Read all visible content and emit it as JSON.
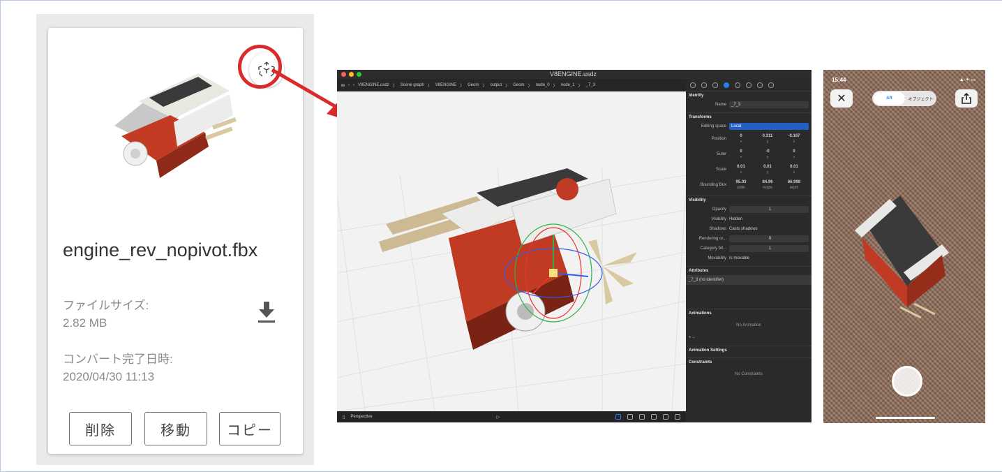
{
  "file_card": {
    "filename": "engine_rev_nopivot.fbx",
    "size_label": "ファイルサイズ:",
    "size_value": "2.82 MB",
    "date_label": "コンバート完了日時:",
    "date_value": "2020/04/30 11:13",
    "buttons": {
      "delete": "削除",
      "move": "移動",
      "copy": "コピー"
    },
    "accent_red": "#d92b2b"
  },
  "reality_composer": {
    "doc_title": "V8ENGINE.usdz",
    "path": [
      "V8ENGINE.usdz",
      "Scene graph",
      "V8ENGINE",
      "Geom",
      "output",
      "Geom",
      "node_0",
      "node_1",
      "_7_3"
    ],
    "bottom_bar": {
      "camera": "Perspective"
    },
    "inspector": {
      "identity_header": "Identity",
      "name_label": "Name",
      "name_value": "_7_3",
      "transforms_header": "Transforms",
      "editing_space_label": "Editing space",
      "editing_space_value": "Local",
      "position_label": "Position",
      "position": [
        "0",
        "0.311",
        "-0.167"
      ],
      "euler_label": "Euler",
      "euler": [
        "0",
        "-0",
        "0"
      ],
      "scale_label": "Scale",
      "scale": [
        "0.01",
        "0.01",
        "0.01"
      ],
      "axis": [
        "x",
        "y",
        "z"
      ],
      "bbox_label": "Bounding Box",
      "bbox": [
        "95.03",
        "84.96",
        "66.998"
      ],
      "bbox_axis": [
        "width",
        "height",
        "depth"
      ],
      "visibility_header": "Visibility",
      "opacity_label": "Opacity",
      "opacity_value": "1",
      "visibility_label": "Visibility",
      "visibility_value": "Hidden",
      "shadows_label": "Shadows",
      "shadows_value": "Casts shadows",
      "rendering_label": "Rendering or...",
      "rendering_value": "0",
      "category_label": "Category bit...",
      "category_value": "1",
      "movability_label": "Movability",
      "movability_value": "Is movable",
      "attributes_header": "Attributes",
      "attribute_value": "_7_3 (no identifier)",
      "animations_header": "Animations",
      "no_animation": "No Animation",
      "animation_settings_header": "Animation Settings",
      "constraints_header": "Constraints",
      "no_constraints": "No Constraints"
    }
  },
  "phone": {
    "time": "15:44",
    "status": "▲ ✦ ▭",
    "close": "✕",
    "segment": [
      "AR",
      "オブジェクト"
    ]
  }
}
